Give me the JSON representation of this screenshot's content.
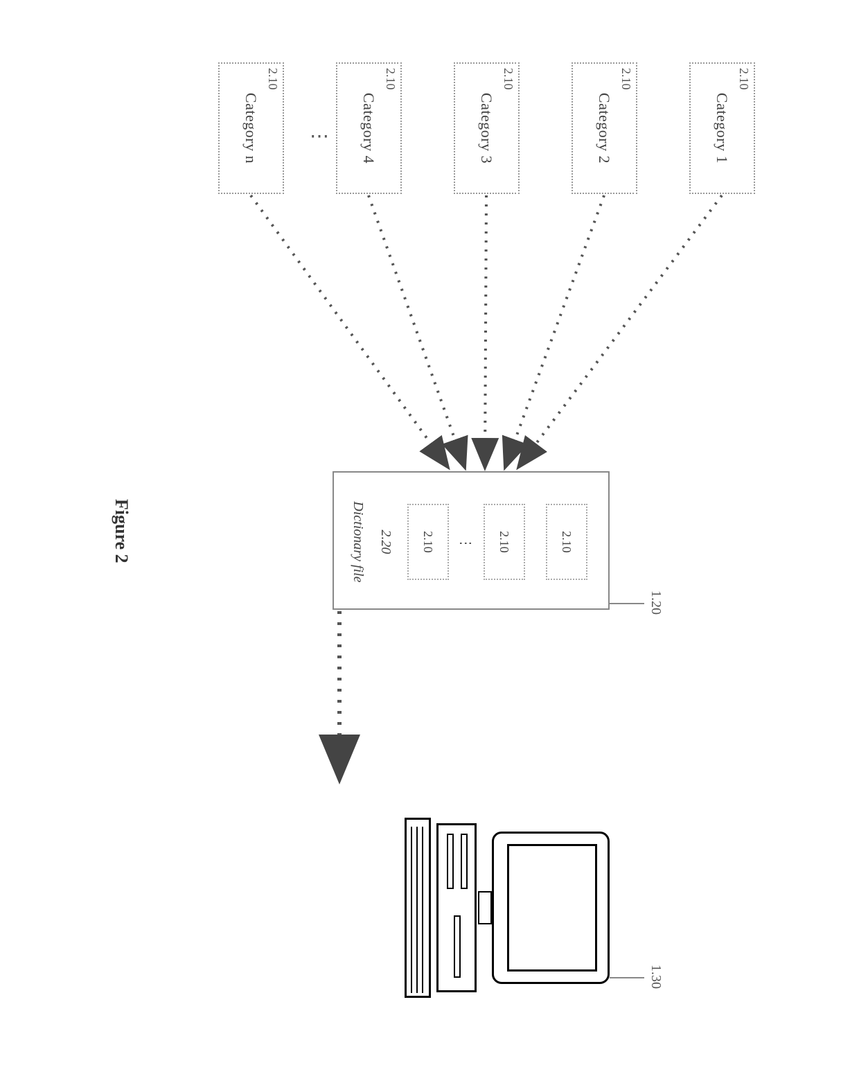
{
  "categories": [
    {
      "ref": "2.10",
      "title": "Category 1"
    },
    {
      "ref": "2.10",
      "title": "Category 2"
    },
    {
      "ref": "2.10",
      "title": "Category 3"
    },
    {
      "ref": "2.10",
      "title": "Category 4"
    },
    {
      "ref": "2.10",
      "title": "Category n"
    }
  ],
  "dictionary": {
    "ref": "1.20",
    "items": [
      {
        "ref": "2.10"
      },
      {
        "ref": "2.10"
      },
      {
        "ref": "2.10"
      }
    ],
    "extra_ref": "2.20",
    "label": "Dictionary file"
  },
  "computer": {
    "ref": "1.30"
  },
  "figure_caption": "Figure 2"
}
